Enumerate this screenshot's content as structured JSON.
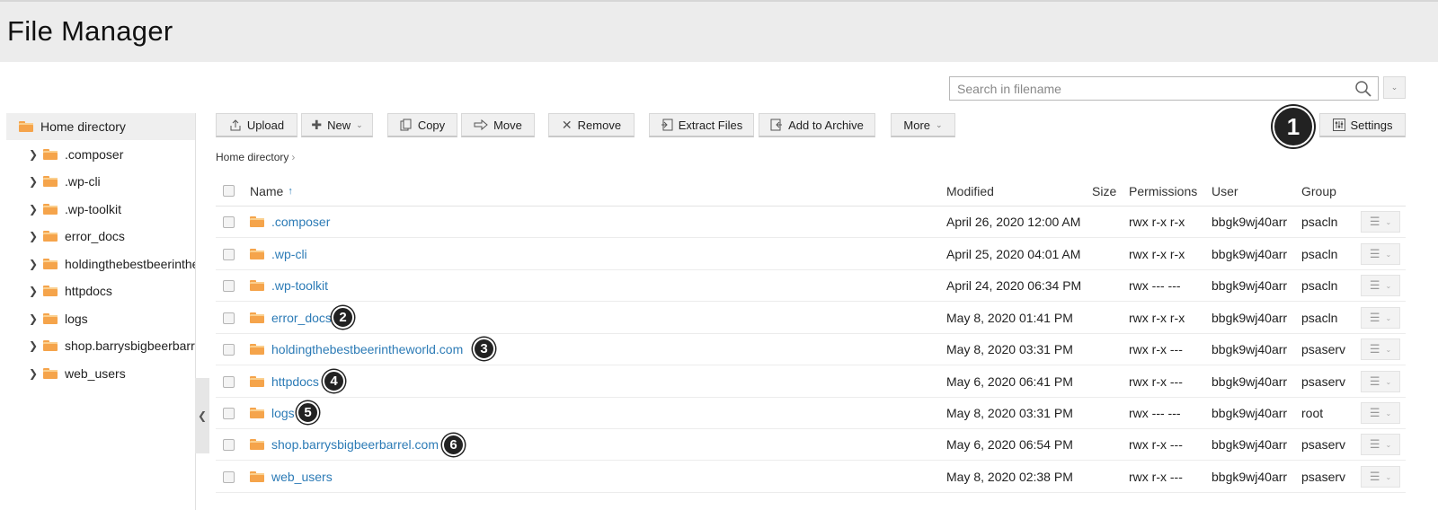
{
  "app": {
    "title": "File Manager"
  },
  "search": {
    "placeholder": "Search in filename"
  },
  "sidebar": {
    "root": "Home directory",
    "items": [
      {
        "label": ".composer"
      },
      {
        "label": ".wp-cli"
      },
      {
        "label": ".wp-toolkit"
      },
      {
        "label": "error_docs"
      },
      {
        "label": "holdingthebestbeerintheworld.com"
      },
      {
        "label": "httpdocs"
      },
      {
        "label": "logs"
      },
      {
        "label": "shop.barrysbigbeerbarrel.com"
      },
      {
        "label": "web_users"
      }
    ]
  },
  "toolbar": {
    "upload": "Upload",
    "new": "New",
    "copy": "Copy",
    "move": "Move",
    "remove": "Remove",
    "extract": "Extract Files",
    "archive": "Add to Archive",
    "more": "More",
    "settings": "Settings"
  },
  "breadcrumb": {
    "home": "Home directory"
  },
  "table": {
    "headers": {
      "name": "Name",
      "modified": "Modified",
      "size": "Size",
      "permissions": "Permissions",
      "user": "User",
      "group": "Group"
    },
    "rows": [
      {
        "name": ".composer",
        "modified": "April 26, 2020 12:00 AM",
        "size": "",
        "permissions": "rwx r-x r-x",
        "user": "bbgk9wj40arr",
        "group": "psacln"
      },
      {
        "name": ".wp-cli",
        "modified": "April 25, 2020 04:01 AM",
        "size": "",
        "permissions": "rwx r-x r-x",
        "user": "bbgk9wj40arr",
        "group": "psacln"
      },
      {
        "name": ".wp-toolkit",
        "modified": "April 24, 2020 06:34 PM",
        "size": "",
        "permissions": "rwx --- ---",
        "user": "bbgk9wj40arr",
        "group": "psacln"
      },
      {
        "name": "error_docs",
        "modified": "May 8, 2020 01:41 PM",
        "size": "",
        "permissions": "rwx r-x r-x",
        "user": "bbgk9wj40arr",
        "group": "psacln"
      },
      {
        "name": "holdingthebestbeerintheworld.com",
        "modified": "May 8, 2020 03:31 PM",
        "size": "",
        "permissions": "rwx r-x ---",
        "user": "bbgk9wj40arr",
        "group": "psaserv"
      },
      {
        "name": "httpdocs",
        "modified": "May 6, 2020 06:41 PM",
        "size": "",
        "permissions": "rwx r-x ---",
        "user": "bbgk9wj40arr",
        "group": "psaserv"
      },
      {
        "name": "logs",
        "modified": "May 8, 2020 03:31 PM",
        "size": "",
        "permissions": "rwx --- ---",
        "user": "bbgk9wj40arr",
        "group": "root"
      },
      {
        "name": "shop.barrysbigbeerbarrel.com",
        "modified": "May 6, 2020 06:54 PM",
        "size": "",
        "permissions": "rwx r-x ---",
        "user": "bbgk9wj40arr",
        "group": "psaserv"
      },
      {
        "name": "web_users",
        "modified": "May 8, 2020 02:38 PM",
        "size": "",
        "permissions": "rwx r-x ---",
        "user": "bbgk9wj40arr",
        "group": "psaserv"
      }
    ]
  },
  "callouts": [
    "1",
    "2",
    "3",
    "4",
    "5",
    "6"
  ],
  "colors": {
    "link": "#2c7bb6",
    "folder": "#f5a44b",
    "header_bg": "#ececec"
  }
}
